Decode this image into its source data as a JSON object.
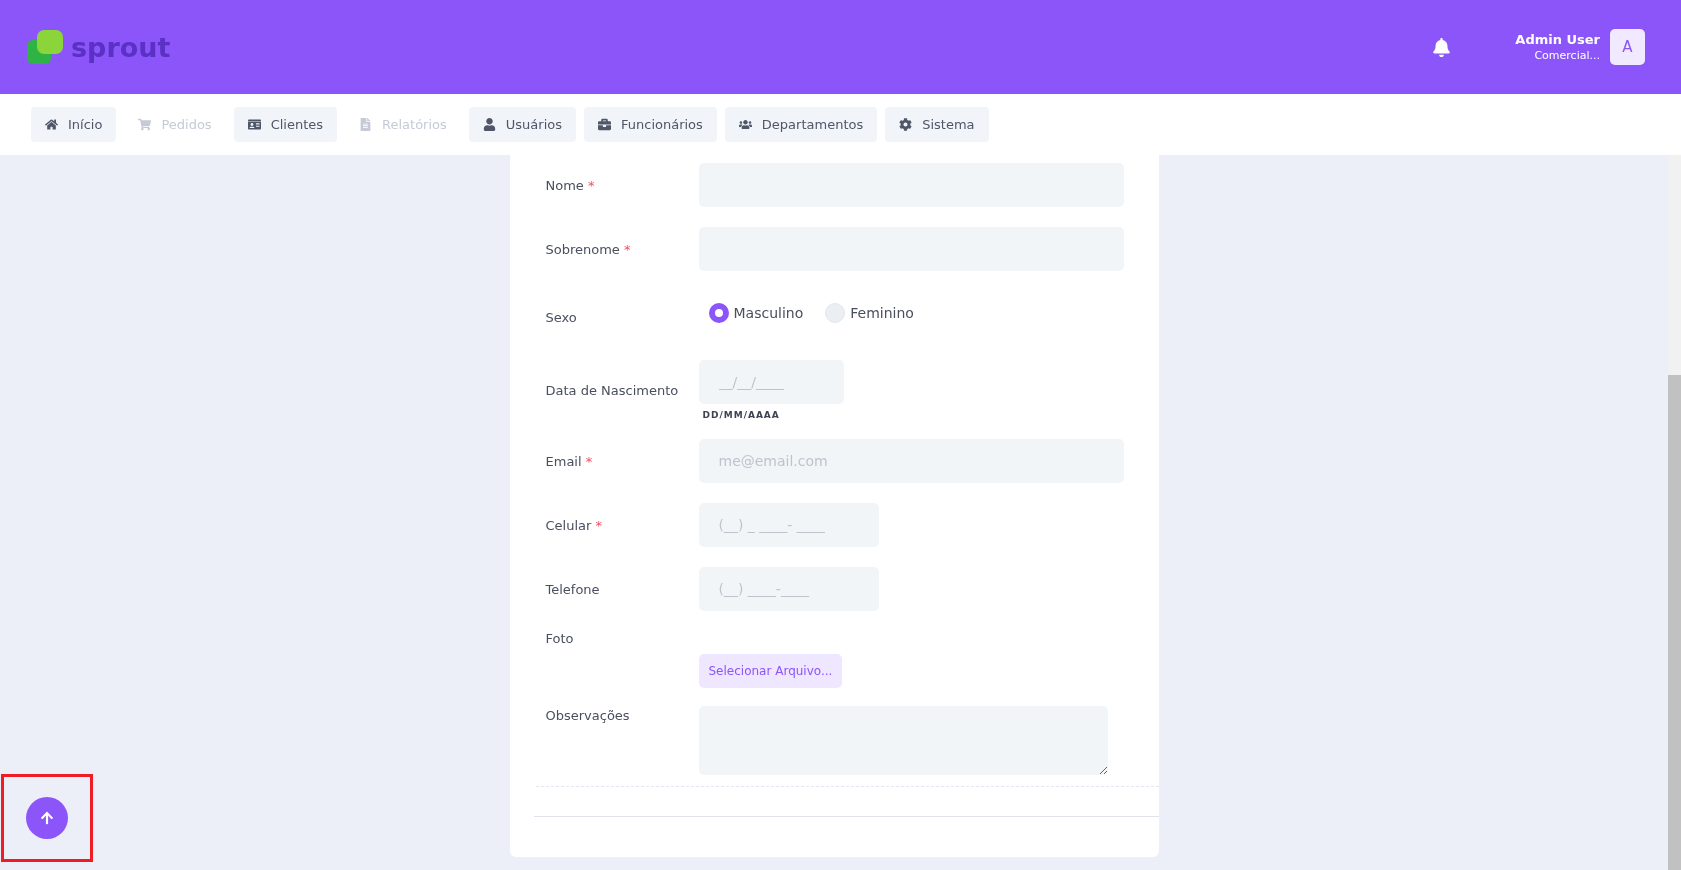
{
  "brand": {
    "name": "sprout"
  },
  "user": {
    "name": "Admin User",
    "role": "Comercial...",
    "avatar_letter": "A"
  },
  "nav": [
    {
      "label": "Início",
      "disabled": false
    },
    {
      "label": "Pedidos",
      "disabled": true
    },
    {
      "label": "Clientes",
      "disabled": false
    },
    {
      "label": "Relatórios",
      "disabled": true
    },
    {
      "label": "Usuários",
      "disabled": false
    },
    {
      "label": "Funcionários",
      "disabled": false
    },
    {
      "label": "Departamentos",
      "disabled": false
    },
    {
      "label": "Sistema",
      "disabled": false
    }
  ],
  "form": {
    "fields": [
      {
        "kind": "text",
        "label": "Nome",
        "required_mark": "*"
      },
      {
        "kind": "text",
        "label": "Sobrenome",
        "required_mark": "*"
      },
      {
        "kind": "radio",
        "label": "Sexo",
        "options": [
          {
            "label": "Masculino",
            "selected": true
          },
          {
            "label": "Feminino",
            "selected": false
          }
        ]
      },
      {
        "kind": "text",
        "label": "Data de Nascimento",
        "placeholder": "__/__/____",
        "hint": "DD/MM/AAAA"
      },
      {
        "kind": "text",
        "label": "Email",
        "required_mark": "*",
        "placeholder": "me@email.com"
      },
      {
        "kind": "text",
        "label": "Celular",
        "required_mark": "*",
        "placeholder": "(__) _ ____- ____"
      },
      {
        "kind": "text",
        "label": "Telefone",
        "placeholder": "(__) ____-____"
      },
      {
        "kind": "file",
        "label": "Foto",
        "button": "Selecionar Arquivo..."
      },
      {
        "kind": "textarea",
        "label": "Observações"
      }
    ]
  }
}
